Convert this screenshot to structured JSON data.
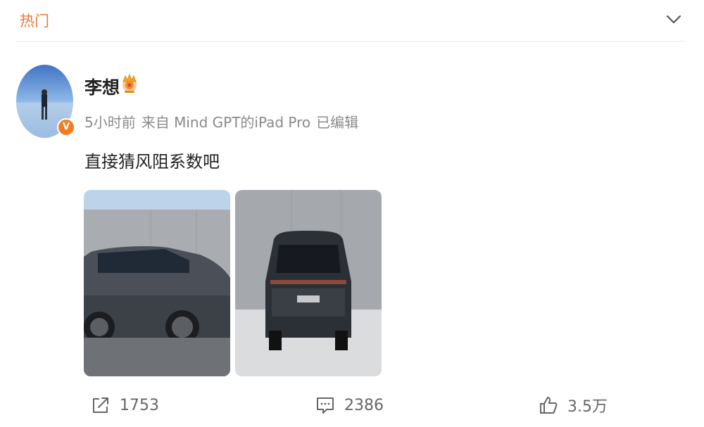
{
  "tabs": {
    "hot_label": "热门"
  },
  "post": {
    "author": "李想",
    "verified_badge": "V",
    "meta": {
      "time": "5小时前",
      "source": "来自 Mind GPT的iPad Pro",
      "edited": "已编辑"
    },
    "text": "直接猜风阻系数吧",
    "images": [
      {
        "icon": "car-side-photo"
      },
      {
        "icon": "car-rear-photo"
      }
    ]
  },
  "actions": {
    "share_count": "1753",
    "comment_count": "2386",
    "like_count": "3.5万"
  },
  "colors": {
    "accent": "#f0753a",
    "badge": "#f57c20",
    "meta": "#8a8a8a"
  }
}
